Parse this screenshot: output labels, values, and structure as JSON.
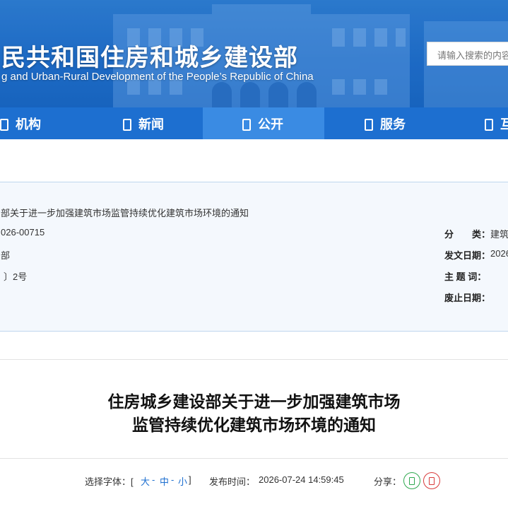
{
  "header": {
    "site_title": "民共和国住房和城乡建设部",
    "site_subtitle": "g and Urban-Rural Development of the People’s Republic of China",
    "search_placeholder": "请输入搜索的内容"
  },
  "nav": {
    "items": [
      {
        "label": "机构",
        "active": false
      },
      {
        "label": "新闻",
        "active": false
      },
      {
        "label": "公开",
        "active": true
      },
      {
        "label": "服务",
        "active": false
      },
      {
        "label": "互",
        "active": false
      }
    ]
  },
  "info": {
    "doc_title": "部关于进一步加强建筑市场监管持续优化建筑市场环境的通知",
    "index_no": "026-00715",
    "issuer": "部",
    "doc_no": "〕2号",
    "category_label": "分　　类：",
    "category_value": "建筑",
    "date_label": "发文日期：",
    "date_value": "2026",
    "subject_label": "主 题 词：",
    "abolish_label": "废止日期："
  },
  "article": {
    "title_line1": "住房城乡建设部关于进一步加强建筑市场",
    "title_line2": "监管持续优化建筑市场环境的通知"
  },
  "meta": {
    "font_label": "选择字体：[",
    "font_large": "大",
    "sep1": "-",
    "font_medium": "中",
    "sep2": "-",
    "font_small": "小",
    "font_close": "]",
    "publish_label": "发布时间：",
    "publish_time": "2026-07-24 14:59:45",
    "share_label": "分享："
  },
  "colors": {
    "nav_bg": "#1d6fd0",
    "nav_active": "#3a8be3",
    "wechat_green": "#2fa84f",
    "weibo_red": "#d83a3a"
  }
}
